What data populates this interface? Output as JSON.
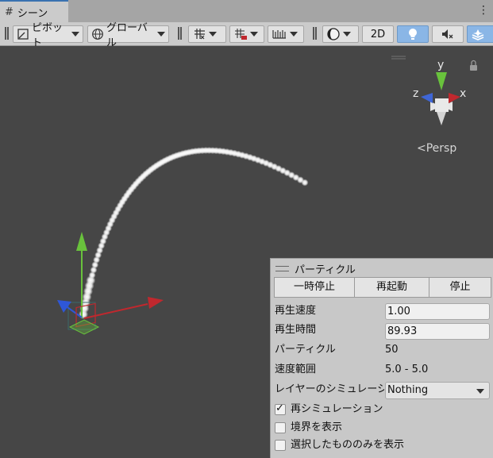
{
  "tab": {
    "icon": "scene-grid-icon",
    "label": "シーン"
  },
  "toolbar": {
    "pivot_label": "ピボット",
    "global_label": "グローバル",
    "mode_2d_label": "2D"
  },
  "gizmo": {
    "y_label": "y",
    "x_label": "x",
    "z_label": "z",
    "persp_label": "<Persp"
  },
  "panel": {
    "title": "パーティクル",
    "buttons": {
      "pause": "一時停止",
      "restart": "再起動",
      "stop": "停止"
    },
    "playback_speed_label": "再生速度",
    "playback_speed_value": "1.00",
    "playback_time_label": "再生時間",
    "playback_time_value": "89.93",
    "particles_label": "パーティクル",
    "particles_value": "50",
    "speed_range_label": "速度範囲",
    "speed_range_value": "5.0 - 5.0",
    "layer_sim_label": "レイヤーのシミュレーショ",
    "layer_sim_value": "Nothing",
    "resimulate_label": "再シミュレーション",
    "resimulate_checked": true,
    "show_bounds_label": "境界を表示",
    "show_bounds_checked": false,
    "show_selected_only_label": "選択したもののみを表示",
    "show_selected_only_checked": false
  },
  "colors": {
    "scene_bg": "#464646",
    "accent_active": "#8ab6e6",
    "axis_x": "#c0282e",
    "axis_y": "#69c23c",
    "axis_z": "#2e57d8"
  }
}
